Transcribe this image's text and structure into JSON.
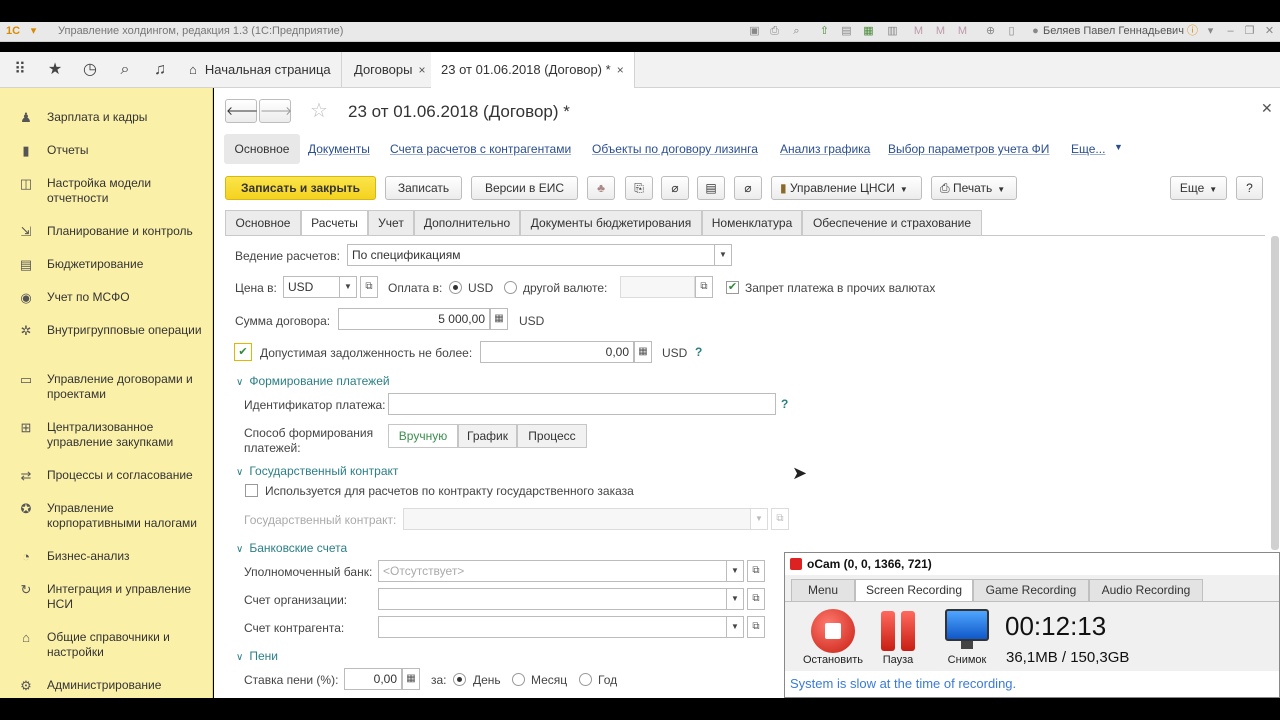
{
  "window": {
    "title": "Управление холдингом, редакция 1.3 (1С:Предприятие)",
    "user": "Беляев Павел Геннадьевич"
  },
  "nav": {
    "tabs": [
      {
        "label": "Начальная страница"
      },
      {
        "label": "Договоры",
        "close": "×"
      },
      {
        "label": "23 от 01.06.2018 (Договор) *",
        "close": "×"
      }
    ]
  },
  "sidebar": {
    "items": [
      {
        "label": "Зарплата и кадры",
        "icon": "person-icon"
      },
      {
        "label": "Отчеты",
        "icon": "bar-chart-icon"
      },
      {
        "label": "Настройка модели отчетности",
        "icon": "model-icon"
      },
      {
        "label": "Планирование и контроль",
        "icon": "planning-icon"
      },
      {
        "label": "Бюджетирование",
        "icon": "budget-icon"
      },
      {
        "label": "Учет по МСФО",
        "icon": "ifrs-icon"
      },
      {
        "label": "Внутригрупповые операции",
        "icon": "gear-icon"
      },
      {
        "label": "Управление договорами и проектами",
        "icon": "contract-icon"
      },
      {
        "label": "Централизованное управление закупками",
        "icon": "purchase-icon"
      },
      {
        "label": "Процессы и согласование",
        "icon": "process-icon"
      },
      {
        "label": "Управление корпоративными налогами",
        "icon": "tax-icon"
      },
      {
        "label": "Бизнес-анализ",
        "icon": "analysis-icon"
      },
      {
        "label": "Интеграция и управление НСИ",
        "icon": "integration-icon"
      },
      {
        "label": "Общие справочники и настройки",
        "icon": "settings-icon"
      },
      {
        "label": "Администрирование",
        "icon": "admin-gear-icon"
      }
    ]
  },
  "doc": {
    "title": "23 от 01.06.2018 (Договор) *",
    "links": [
      "Основное",
      "Документы",
      "Счета расчетов с контрагентами",
      "Объекты по договору лизинга",
      "Анализ графика",
      "Выбор параметров учета ФИ",
      "Еще..."
    ],
    "toolbar": {
      "save_close": "Записать и закрыть",
      "save": "Записать",
      "versions": "Версии в ЕИС",
      "nsi": "Управление ЦНСИ",
      "print": "Печать",
      "more": "Еще",
      "help": "?"
    },
    "tabs": [
      "Основное",
      "Расчеты",
      "Учет",
      "Дополнительно",
      "Документы бюджетирования",
      "Номенклатура",
      "Обеспечение и страхование"
    ],
    "active_tab": "Расчеты"
  },
  "form": {
    "settlement_label": "Ведение расчетов:",
    "settlement_value": "По спецификациям",
    "price_label": "Цена в:",
    "price_currency": "USD",
    "payment_label": "Оплата в:",
    "payment_opt1": "USD",
    "payment_opt2": "другой валюте:",
    "payment_selected": "USD",
    "ban_label": "Запрет платежа в прочих валютах",
    "ban_checked": true,
    "sum_label": "Сумма договора:",
    "sum_value": "5 000,00",
    "sum_currency": "USD",
    "debt_checked": true,
    "debt_label": "Допустимая задолженность не более:",
    "debt_value": "0,00",
    "debt_currency": "USD",
    "help_mark": "?",
    "group_payments": "Формирование платежей",
    "payment_id_label": "Идентификатор платежа:",
    "payment_id_value": "",
    "method_label": "Способ формирования платежей:",
    "methods": [
      "Вручную",
      "График",
      "Процесс"
    ],
    "method_selected": "Вручную",
    "group_gov": "Государственный контракт",
    "gov_used_label": "Используется для расчетов по контракту государственного заказа",
    "gov_used_checked": false,
    "gov_contract_label": "Государственный контракт:",
    "group_bank": "Банковские счета",
    "bank_label": "Уполномоченный банк:",
    "bank_placeholder": "<Отсутствует>",
    "org_account_label": "Счет организации:",
    "counterparty_account_label": "Счет контрагента:",
    "group_penalty": "Пени",
    "penalty_rate_label": "Ставка пени (%):",
    "penalty_rate_value": "0,00",
    "penalty_for_label": "за:",
    "penalty_periods": [
      "День",
      "Месяц",
      "Год"
    ],
    "penalty_period_selected": "День"
  },
  "ocam": {
    "title": "oCam (0, 0, 1366, 721)",
    "tabs": [
      "Menu",
      "Screen Recording",
      "Game Recording",
      "Audio Recording"
    ],
    "active_tab": "Screen Recording",
    "stop_label": "Остановить",
    "pause_label": "Пауза",
    "snapshot_label": "Снимок",
    "time": "00:12:13",
    "size": "36,1MB / 150,3GB",
    "status": "System is slow at the time of recording."
  },
  "colors": {
    "sidebar_bg": "#fbf0a8",
    "primary_button": "#f4d21f",
    "link": "#2a4e8f",
    "group_header": "#2b7f86",
    "record_red": "#e03a2f"
  }
}
